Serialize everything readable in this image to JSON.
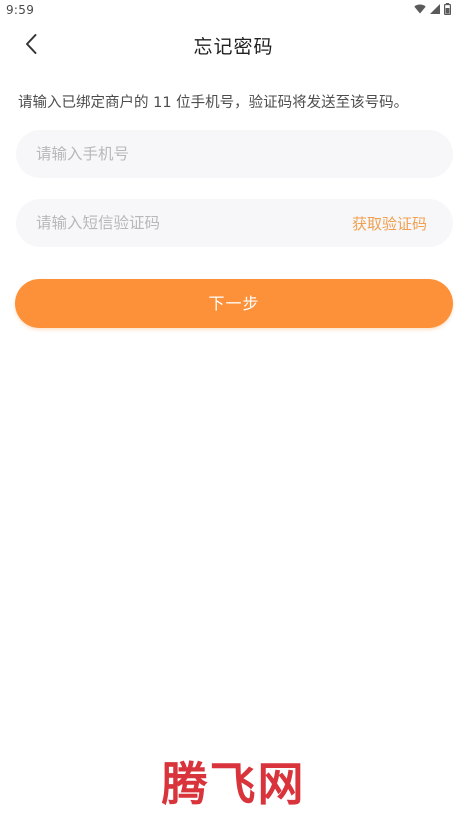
{
  "status_bar": {
    "time": "9:59",
    "icons": [
      "wifi-icon",
      "signal-icon",
      "battery-icon"
    ]
  },
  "header": {
    "title": "忘记密码",
    "back_icon": "chevron-left-icon"
  },
  "instruction": "请输入已绑定商户的 11 位手机号，验证码将发送至该号码。",
  "phone_field": {
    "placeholder": "请输入手机号",
    "value": ""
  },
  "code_field": {
    "placeholder": "请输入短信验证码",
    "value": "",
    "get_code_label": "获取验证码"
  },
  "next_button": {
    "label": "下一步"
  },
  "watermark": "腾飞网",
  "colors": {
    "accent": "#fd9139",
    "link": "#f0a050",
    "field_bg": "#f7f7f9",
    "watermark": "#d9343c"
  }
}
